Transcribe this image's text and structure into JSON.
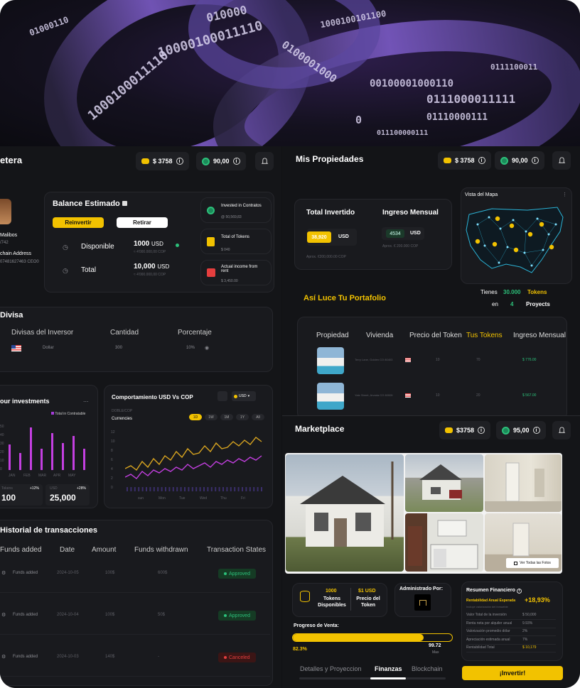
{
  "colors": {
    "accent": "#f2c200",
    "bg": "#141518",
    "green": "#2cc07a",
    "purple": "#a43bd8",
    "red": "#e53e3e"
  },
  "hero": {
    "bits": [
      "010000",
      "10000100011110",
      "1000100011110",
      "0100001000",
      "1000100101100",
      "00100001000110",
      "0111000011111",
      "01000110",
      "0111100011",
      "0110000011",
      "0111000",
      "0111000011",
      "1000",
      "0",
      "01110000111",
      "011100000111"
    ]
  },
  "wallet": {
    "title": "etera",
    "header": {
      "balance": "$ 3758",
      "tokens": "90,00"
    },
    "profile": {
      "name": "Malibos",
      "sub": "/742",
      "address_label": "chain Address",
      "address": "07481627463 CEO0"
    },
    "balance_card": {
      "title": "Balance Estimado",
      "reinvest": "Reinvertir",
      "withdraw": "Retirar",
      "available_label": "Disponible",
      "available_value": "1000",
      "available_unit": "USD",
      "available_sub": "≈ 4'000.000,00 COP",
      "total_label": "Total",
      "total_value": "10,000",
      "total_unit": "USD",
      "total_sub": "≈ 4'000.000,00 COP"
    },
    "stats": [
      {
        "label": "Invested in Contratos",
        "value": "@ 50,569,83"
      },
      {
        "label": "Total of Tokens",
        "value": "$ 040"
      },
      {
        "label": "Actual income from rent",
        "value": "$ 3,450.00"
      }
    ],
    "currency": {
      "title": "Divisa",
      "headers": [
        "Divisas del Inversor",
        "Cantidad",
        "Porcentaje"
      ],
      "row": {
        "name": "Dollar",
        "amount": "300",
        "percent": "10%"
      }
    },
    "investments": {
      "title": "our investments",
      "more": "...",
      "legend": "Total in Contratable",
      "yaxis": [
        "50",
        "40",
        "30",
        "20",
        "10",
        "0"
      ],
      "months": [
        "JAN",
        "FEB",
        "MAR",
        "APR",
        "MAY"
      ],
      "tokens_label": "Tokens",
      "tokens_pct": "+12%",
      "tokens_value": "100",
      "usd_label": "USD",
      "usd_pct": "+28%",
      "usd_value": "25,000"
    },
    "comparison": {
      "title": "Comportamiento USD Vs COP",
      "sub": "DOBLE/COP",
      "currencies": "Currencies",
      "range_tabs": [
        "1D",
        "1W",
        "1M",
        "1Y",
        "All"
      ],
      "x_labels": [
        "sun",
        "Mon",
        "Tue",
        "Wed",
        "Thu",
        "Fri"
      ],
      "yaxis": [
        "12",
        "10",
        "8",
        "6",
        "4",
        "2",
        "0"
      ],
      "currency": "USD"
    },
    "history": {
      "title": "Historial de transacciones",
      "headers": [
        "Funds added",
        "Date",
        "Amount",
        "Funds withdrawn",
        "Transaction States"
      ],
      "rows": [
        {
          "type": "Funds added",
          "date": "2024-10-05",
          "amount": "100$",
          "withdrawn": "600$",
          "state": "Approved",
          "status": "ok"
        },
        {
          "type": "Funds added",
          "date": "2024-10-04",
          "amount": "100$",
          "withdrawn": "50$",
          "state": "Approved",
          "status": "ok"
        },
        {
          "type": "Funds added",
          "date": "2024-10-03",
          "amount": "140$",
          "withdrawn": "-",
          "state": "Canceled",
          "status": "bad"
        }
      ]
    }
  },
  "properties": {
    "title": "Mis Propiedades",
    "header": {
      "balance": "$ 3758",
      "tokens": "90,00"
    },
    "invested": {
      "label": "Total Invertido",
      "value": "38,920",
      "unit": "USD",
      "sub": "Aprox. €200,000.00 COP"
    },
    "income": {
      "label": "Ingreso Mensual",
      "value": "4534",
      "unit": "USD",
      "sub": "Aprox. € 200.000 COP"
    },
    "map": {
      "title": "Vista del Mapa",
      "more": "⋮"
    },
    "portfolio": {
      "title": "Así Luce Tu Portafolio",
      "tienes": "Tienes",
      "tokens_count": "30.000",
      "tokens_label": "Tokens",
      "en": "en",
      "projects_count": "4",
      "projects_label": "Proyects"
    },
    "table": {
      "headers": [
        "Propiedad",
        "Vivienda",
        "Precio del Token",
        "Tus Tokens",
        "Ingreso Mensual"
      ],
      "rows": [
        {
          "address": "Terry Lane, Golden CO 80403",
          "price": "10",
          "tokens": "70",
          "income": "$ 776.00"
        },
        {
          "address": "Yale Street, Arvada CO 80005",
          "price": "10",
          "tokens": "20",
          "income": "$ 567.00"
        }
      ]
    }
  },
  "market": {
    "title": "Marketplace",
    "header": {
      "balance": "$3758",
      "tokens": "95,00"
    },
    "gallery_button": "Ver Todas las Fotos",
    "tokens": {
      "value": "1000",
      "label": "Tokens Disponibles"
    },
    "price": {
      "value": "$1 USD",
      "label": "Precio del Token"
    },
    "admin": "Administrado Por:",
    "progress": {
      "label": "Progreso de Venta:",
      "percent_text": "82.3%",
      "percent": 0.823,
      "max_value": "99.72",
      "max_label": "Max"
    },
    "tabs": [
      "Detalles y Proyeccion",
      "Finanzas",
      "Blockchain"
    ],
    "summary": {
      "title": "Resumen Financiero",
      "roi_label": "Rentabilidad Anual Esperada",
      "roi_value": "+18,93%",
      "roi_sub": "Incluye valorización del inmueble",
      "rows": [
        {
          "label": "Valor Total de la inversión",
          "value": "$ 50,000"
        },
        {
          "label": "Renta neta por alquiler anual",
          "value": "9.93%"
        },
        {
          "label": "Valorización promedio dólar",
          "value": "2%"
        },
        {
          "label": "Apreciación estimada anual",
          "value": "7%"
        },
        {
          "label": "Rentabilidad Total",
          "value": "$ 10,179"
        }
      ]
    },
    "invest_button": "¡Invertir!"
  }
}
